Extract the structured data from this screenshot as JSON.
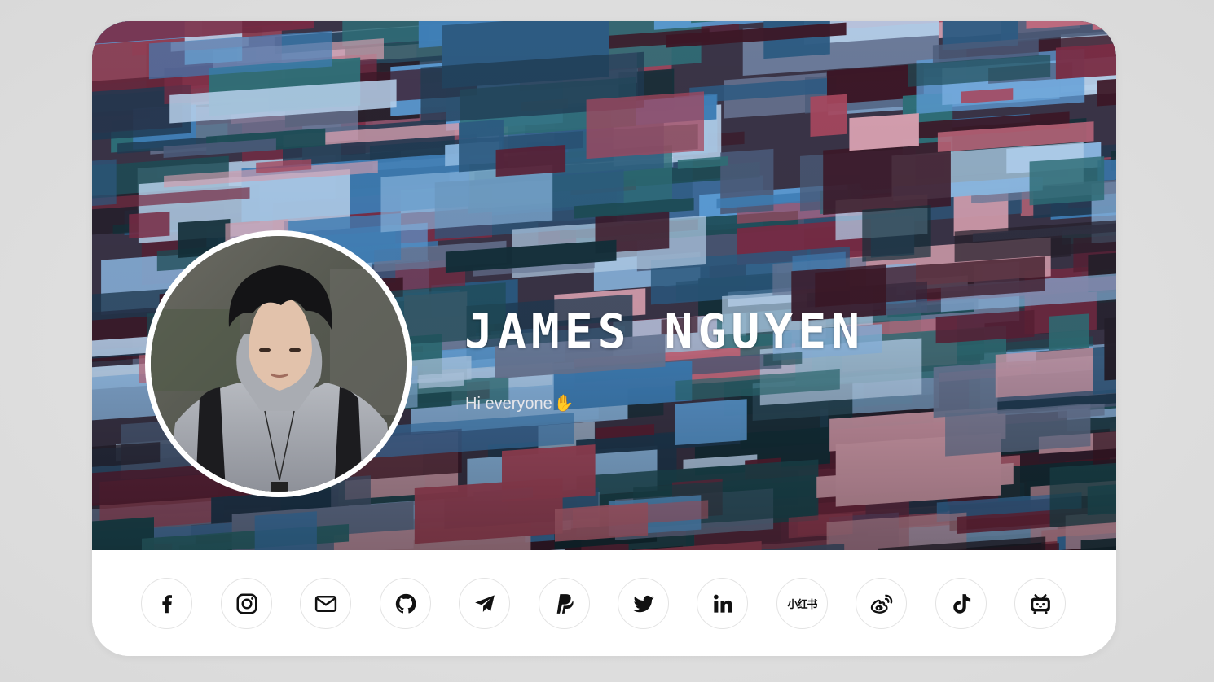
{
  "profile": {
    "name": "JAMES NGUYEN",
    "bio": "Hi everyone",
    "bio_emoji": "✋"
  },
  "social_links": [
    {
      "name": "facebook",
      "icon": "facebook-icon"
    },
    {
      "name": "instagram",
      "icon": "instagram-icon"
    },
    {
      "name": "email",
      "icon": "mail-icon"
    },
    {
      "name": "github",
      "icon": "github-icon"
    },
    {
      "name": "telegram",
      "icon": "telegram-icon"
    },
    {
      "name": "paypal",
      "icon": "paypal-icon"
    },
    {
      "name": "twitter",
      "icon": "twitter-icon"
    },
    {
      "name": "linkedin",
      "icon": "linkedin-icon",
      "label": "in"
    },
    {
      "name": "xiaohongshu",
      "icon": "xiaohongshu-icon",
      "label": "小红书"
    },
    {
      "name": "weibo",
      "icon": "weibo-icon"
    },
    {
      "name": "tiktok",
      "icon": "tiktok-icon"
    },
    {
      "name": "bilibili",
      "icon": "bilibili-icon"
    }
  ],
  "colors": {
    "page_background": "#dcdcdc",
    "card_background": "#ffffff",
    "name_text": "#ffffff",
    "bio_text": "#e6e6ea",
    "icon_color": "#111111",
    "button_border": "#e3e3e3"
  }
}
